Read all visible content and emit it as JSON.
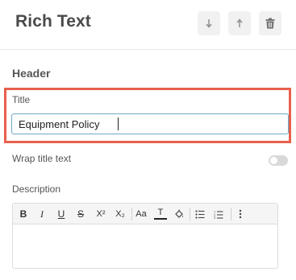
{
  "panel": {
    "title": "Rich Text",
    "buttons": {
      "move_down_icon": "arrow-down-icon",
      "move_up_icon": "arrow-up-icon",
      "delete_icon": "trash-icon"
    }
  },
  "section": {
    "title": "Header"
  },
  "title_field": {
    "label": "Title",
    "value": "Equipment Policy",
    "highlight_color": "#e8604c"
  },
  "wrap_title": {
    "label": "Wrap title text",
    "enabled": false
  },
  "description": {
    "label": "Description",
    "toolbar": {
      "bold": "B",
      "italic": "I",
      "underline": "U",
      "strike": "S",
      "superscript": "X²",
      "subscript": "X₂",
      "font_size": "Aa",
      "text_color": "T"
    }
  }
}
